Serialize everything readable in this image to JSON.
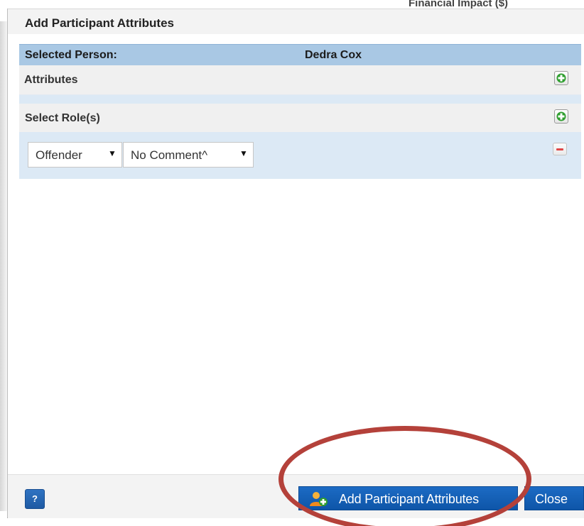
{
  "background": {
    "partial_heading": "Financial Impact ($)"
  },
  "dialog": {
    "title": "Add Participant Attributes",
    "selected_person_label": "Selected Person:",
    "selected_person_name": "Dedra Cox",
    "attributes_label": "Attributes",
    "select_roles_label": "Select Role(s)",
    "role_dropdown": {
      "selected": "Offender",
      "caret": "▼"
    },
    "comment_dropdown": {
      "selected": "No Comment^",
      "caret": "▼"
    }
  },
  "footer": {
    "help_label": "?",
    "primary_label": "Add Participant Attributes",
    "close_label": "Close"
  },
  "icons": {
    "add": "add-green-plus-icon",
    "remove": "remove-red-minus-icon",
    "primary": "add-person-icon"
  },
  "colors": {
    "header_blue": "#a9c8e4",
    "button_blue": "#1560b8",
    "add_green": "#2f9e2f",
    "remove_red": "#e04747",
    "annotation_red": "#b4413a"
  }
}
